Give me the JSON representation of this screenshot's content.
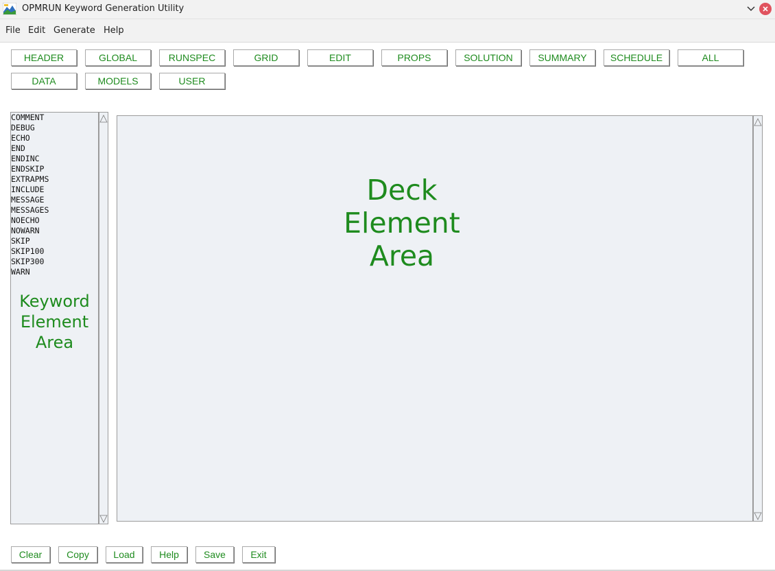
{
  "window": {
    "title": "OPMRUN Keyword Generation Utility",
    "icons": {
      "app": "opmrun-app-icon",
      "minimize": "chevron-down-icon",
      "close": "close-icon"
    },
    "colors": {
      "close": "#e0525e",
      "accent_text": "#1e8b1e"
    }
  },
  "menu": [
    "File",
    "Edit",
    "Generate",
    "Help"
  ],
  "section_buttons_row1": [
    "HEADER",
    "GLOBAL",
    "RUNSPEC",
    "GRID",
    "EDIT",
    "PROPS",
    "SOLUTION",
    "SUMMARY",
    "SCHEDULE",
    "ALL"
  ],
  "section_buttons_row2": [
    "DATA",
    "MODELS",
    "USER"
  ],
  "keyword_list": [
    "COMMENT",
    "DEBUG",
    "ECHO",
    "END",
    "ENDINC",
    "ENDSKIP",
    "EXTRAPMS",
    "INCLUDE",
    "MESSAGE",
    "MESSAGES",
    "NOECHO",
    "NOWARN",
    "SKIP",
    "SKIP100",
    "SKIP300",
    "WARN"
  ],
  "keyword_area_label": [
    "Keyword",
    "Element",
    "Area"
  ],
  "deck_area_label": [
    "Deck",
    "Element",
    "Area"
  ],
  "bottom_buttons": [
    "Clear",
    "Copy",
    "Load",
    "Help",
    "Save",
    "Exit"
  ]
}
